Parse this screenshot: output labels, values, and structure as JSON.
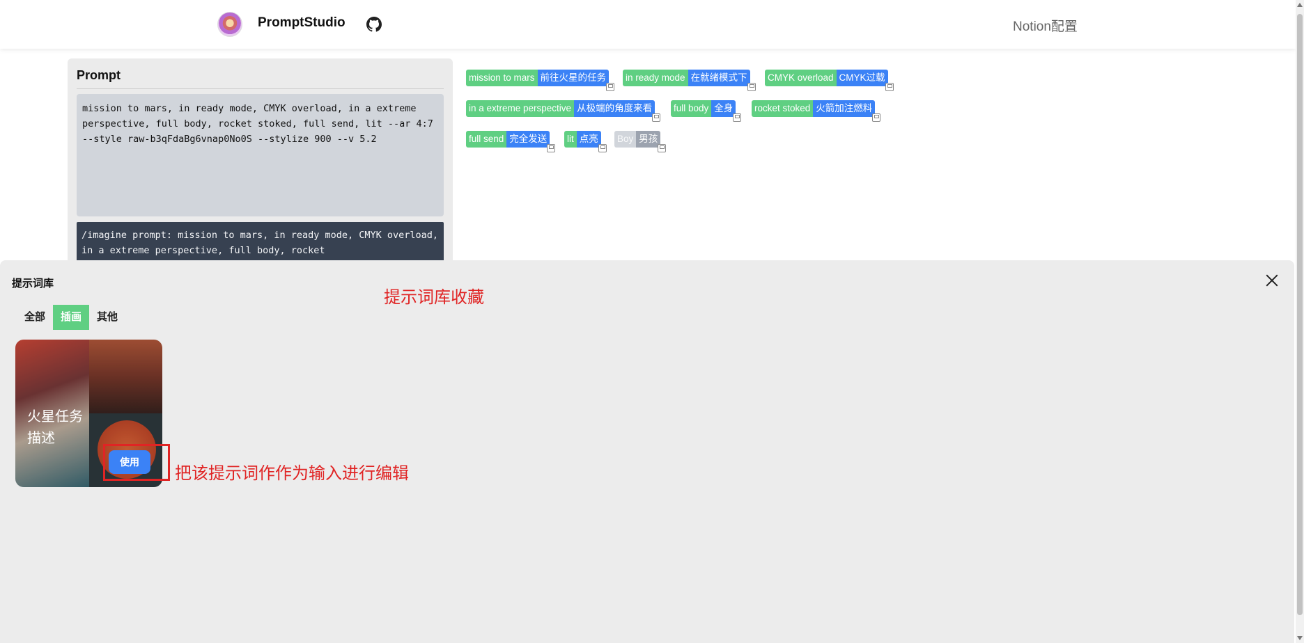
{
  "header": {
    "brand": "PromptStudio",
    "notion_link": "Notion配置"
  },
  "prompt": {
    "title": "Prompt",
    "text": "mission to mars, in ready mode, CMYK overload, in a extreme perspective, full body, rocket stoked, full send, lit --ar 4:7 --style raw-b3qFdaBg6vnap0No0S --stylize 900 --v 5.2",
    "command": "/imagine prompt: mission to mars, in ready mode, CMYK overload, in a extreme perspective, full body, rocket"
  },
  "tags": [
    {
      "en": "mission to mars",
      "zh": "前往火星的任务",
      "active": true
    },
    {
      "en": "in ready mode",
      "zh": "在就绪模式下",
      "active": true
    },
    {
      "en": "CMYK overload",
      "zh": "CMYK过载",
      "active": true
    },
    {
      "en": "in a extreme perspective",
      "zh": "从极端的角度来看",
      "active": true
    },
    {
      "en": "full body",
      "zh": "全身",
      "active": true
    },
    {
      "en": "rocket stoked",
      "zh": "火箭加注燃料",
      "active": true
    },
    {
      "en": "full send",
      "zh": "完全发送",
      "active": true
    },
    {
      "en": "lit",
      "zh": "点亮",
      "active": true
    },
    {
      "en": "Boy",
      "zh": "男孩",
      "active": false
    }
  ],
  "library": {
    "title": "提示词库",
    "annotation": "提示词库收藏",
    "tabs": [
      "全部",
      "插画",
      "其他"
    ],
    "active_tab": "插画",
    "card": {
      "label": "火星任务描述",
      "use_button": "使用"
    },
    "use_annotation": "把该提示词作作为输入进行编辑"
  },
  "colors": {
    "green": "#5fcf82",
    "blue": "#3b82f6",
    "annotation_red": "#e02424"
  }
}
